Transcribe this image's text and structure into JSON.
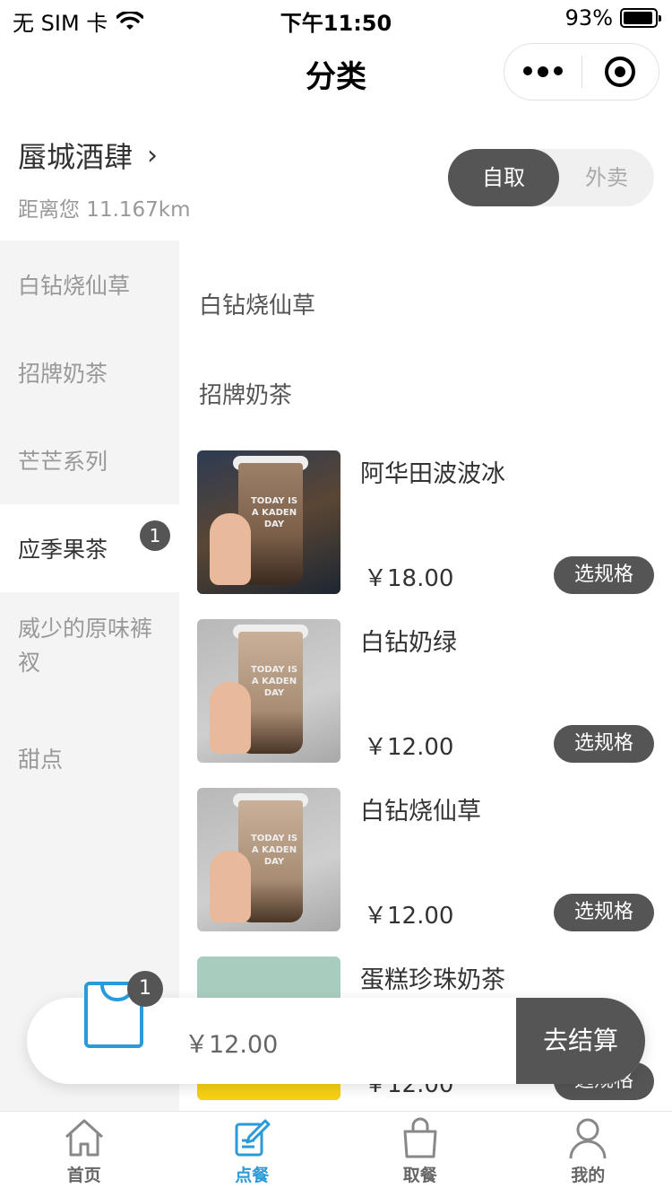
{
  "status_bar": {
    "carrier": "无 SIM 卡",
    "time": "下午11:50",
    "battery": "93%"
  },
  "nav": {
    "title": "分类"
  },
  "store": {
    "name": "蜃城酒肆",
    "chevron": "›",
    "distance": "距离您 11.167km"
  },
  "mode_toggle": {
    "pickup": "自取",
    "delivery": "外卖",
    "selected": "自取"
  },
  "categories": [
    {
      "label": "白钻烧仙草"
    },
    {
      "label": "招牌奶茶"
    },
    {
      "label": "芒芒系列"
    },
    {
      "label": "应季果茶",
      "badge": "1",
      "active": true
    },
    {
      "label": "威少的原味裤衩"
    },
    {
      "label": "甜点"
    }
  ],
  "sections": [
    {
      "title": "白钻烧仙草"
    },
    {
      "title": "招牌奶茶"
    }
  ],
  "products": [
    {
      "name": "阿华田波波冰",
      "price": "￥18.00",
      "spec_label": "选规格",
      "cup_text": "TODAY IS A KADEN DAY"
    },
    {
      "name": "白钻奶绿",
      "price": "￥12.00",
      "spec_label": "选规格",
      "cup_text": "TODAY IS A KADEN DAY"
    },
    {
      "name": "白钻烧仙草",
      "price": "￥12.00",
      "spec_label": "选规格",
      "cup_text": "TODAY IS A KADEN DAY"
    },
    {
      "name": "蛋糕珍珠奶茶",
      "price": "￥12.00",
      "spec_label": "选规格"
    }
  ],
  "cart": {
    "count": "1",
    "total": "￥12.00",
    "checkout_label": "去结算"
  },
  "tabbar": [
    {
      "label": "首页",
      "icon": "home-icon"
    },
    {
      "label": "点餐",
      "icon": "order-icon",
      "active": true
    },
    {
      "label": "取餐",
      "icon": "bag-icon"
    },
    {
      "label": "我的",
      "icon": "user-icon"
    }
  ],
  "colors": {
    "accent": "#2a9ad9",
    "dark_button": "#555555",
    "sidebar_bg": "#f4f4f4"
  }
}
